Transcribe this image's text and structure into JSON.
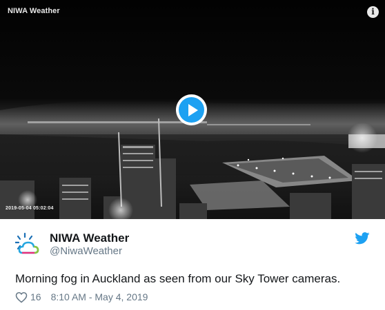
{
  "video": {
    "title": "NIWA Weather",
    "info_glyph": "i",
    "play_icon": "play-icon",
    "timestamp": "2019-05-04 05:02:04"
  },
  "tweet": {
    "author_name": "NIWA Weather",
    "handle": "@NiwaWeather",
    "text": "Morning fog in Auckland as seen from our Sky Tower cameras.",
    "like_count": "16",
    "datetime": "8:10 AM - May 4, 2019"
  },
  "icons": {
    "avatar": "niwa-logo-icon",
    "brand": "twitter-bird-icon",
    "like": "heart-icon"
  },
  "colors": {
    "accent": "#1da1f2",
    "text": "#14171a",
    "secondary": "#657786"
  }
}
